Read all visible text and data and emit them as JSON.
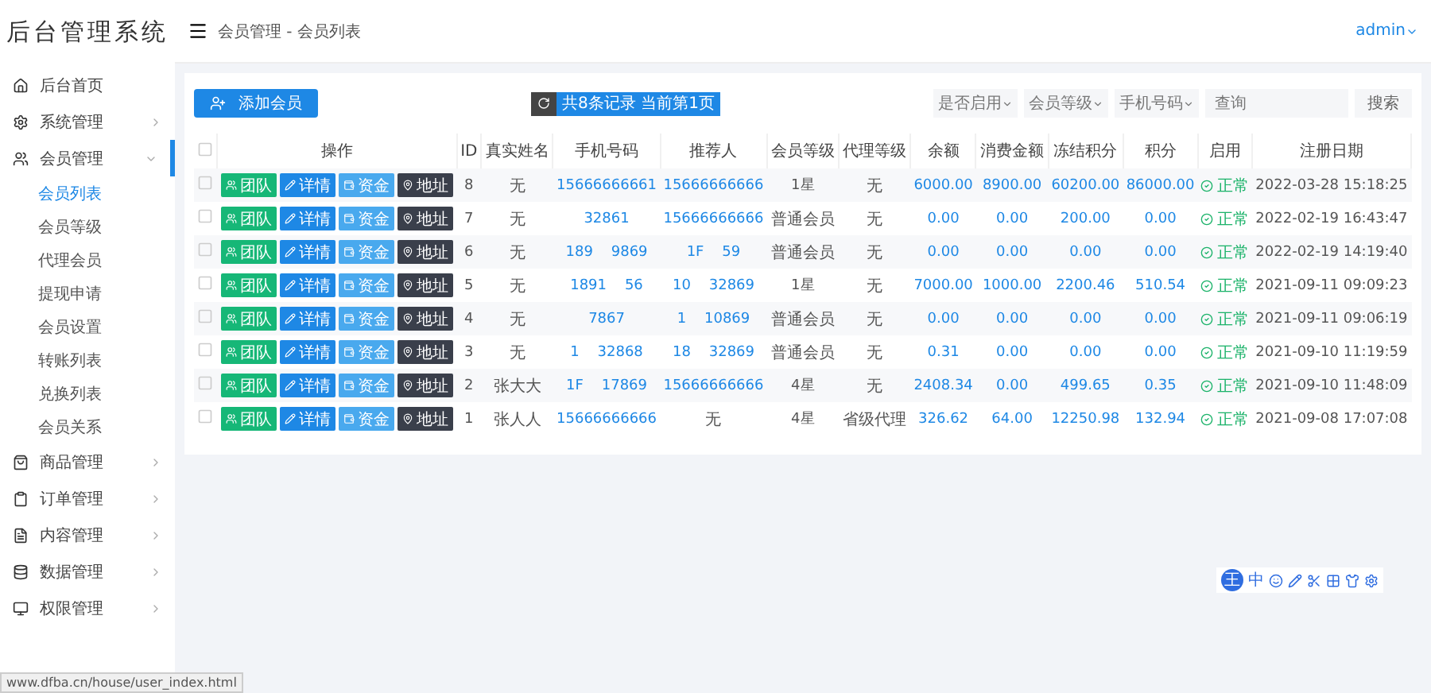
{
  "brand": "后台管理系统",
  "breadcrumb": "会员管理 - 会员列表",
  "user": "admin",
  "sidebar": {
    "items": [
      {
        "label": "后台首页",
        "expanded": false
      },
      {
        "label": "系统管理",
        "expanded": false
      },
      {
        "label": "会员管理",
        "expanded": true,
        "children": [
          {
            "label": "会员列表",
            "selected": true
          },
          {
            "label": "会员等级",
            "selected": false
          },
          {
            "label": "代理会员",
            "selected": false
          },
          {
            "label": "提现申请",
            "selected": false
          },
          {
            "label": "会员设置",
            "selected": false
          },
          {
            "label": "转账列表",
            "selected": false
          },
          {
            "label": "兑换列表",
            "selected": false
          },
          {
            "label": "会员关系",
            "selected": false
          }
        ]
      },
      {
        "label": "商品管理",
        "expanded": false
      },
      {
        "label": "订单管理",
        "expanded": false
      },
      {
        "label": "内容管理",
        "expanded": false
      },
      {
        "label": "数据管理",
        "expanded": false
      },
      {
        "label": "权限管理",
        "expanded": false
      }
    ]
  },
  "toolbar": {
    "add_button": "添加会员",
    "record_info": "共8条记录 当前第1页",
    "filters": [
      "是否启用",
      "会员等级",
      "手机号码"
    ],
    "search": {
      "placeholder": "查询"
    },
    "search_button": "搜索"
  },
  "table": {
    "select_all": {
      "checked": false
    },
    "columns": [
      "操作",
      "ID",
      "真实姓名",
      "手机号码",
      "推荐人",
      "会员等级",
      "代理等级",
      "余额",
      "消费金额",
      "冻结积分",
      "积分",
      "启用",
      "注册日期"
    ],
    "rows": [
      {
        "checked": false,
        "actions": [
          "团队",
          "详情",
          "资金",
          "地址"
        ],
        "id": "8",
        "name": "无",
        "phone": "15666666661",
        "referrer": "15666666666",
        "level": "1星",
        "agent": "无",
        "balance": "6000.00",
        "spent": "8900.00",
        "frozen": "60200.00",
        "points": "86000.00",
        "status": "正常",
        "date": "2022-03-28 15:18:25"
      },
      {
        "checked": false,
        "actions": [
          "团队",
          "详情",
          "资金",
          "地址"
        ],
        "id": "7",
        "name": "无",
        "phone": "32861",
        "referrer": "15666666666",
        "level": "普通会员",
        "agent": "无",
        "balance": "0.00",
        "spent": "0.00",
        "frozen": "200.00",
        "points": "0.00",
        "status": "正常",
        "date": "2022-02-19 16:43:47"
      },
      {
        "checked": false,
        "actions": [
          "团队",
          "详情",
          "资金",
          "地址"
        ],
        "id": "6",
        "name": "无",
        "phone": "189    9869",
        "referrer": "1F    59",
        "level": "普通会员",
        "agent": "无",
        "balance": "0.00",
        "spent": "0.00",
        "frozen": "0.00",
        "points": "0.00",
        "status": "正常",
        "date": "2022-02-19 14:19:40"
      },
      {
        "checked": false,
        "actions": [
          "团队",
          "详情",
          "资金",
          "地址"
        ],
        "id": "5",
        "name": "无",
        "phone": "1891    56",
        "referrer": "10    32869",
        "level": "1星",
        "agent": "无",
        "balance": "7000.00",
        "spent": "1000.00",
        "frozen": "2200.46",
        "points": "510.54",
        "status": "正常",
        "date": "2021-09-11 09:09:23"
      },
      {
        "checked": false,
        "actions": [
          "团队",
          "详情",
          "资金",
          "地址"
        ],
        "id": "4",
        "name": "无",
        "phone": "7867",
        "referrer": "1    10869",
        "level": "普通会员",
        "agent": "无",
        "balance": "0.00",
        "spent": "0.00",
        "frozen": "0.00",
        "points": "0.00",
        "status": "正常",
        "date": "2021-09-11 09:06:19"
      },
      {
        "checked": false,
        "actions": [
          "团队",
          "详情",
          "资金",
          "地址"
        ],
        "id": "3",
        "name": "无",
        "phone": "1    32868",
        "referrer": "18    32869",
        "level": "普通会员",
        "agent": "无",
        "balance": "0.31",
        "spent": "0.00",
        "frozen": "0.00",
        "points": "0.00",
        "status": "正常",
        "date": "2021-09-10 11:19:59"
      },
      {
        "checked": false,
        "actions": [
          "团队",
          "详情",
          "资金",
          "地址"
        ],
        "id": "2",
        "name": "张大大",
        "phone": "1F    17869",
        "referrer": "15666666666",
        "level": "4星",
        "agent": "无",
        "balance": "2408.34",
        "spent": "0.00",
        "frozen": "499.65",
        "points": "0.35",
        "status": "正常",
        "date": "2021-09-10 11:48:09"
      },
      {
        "checked": false,
        "actions": [
          "团队",
          "详情",
          "资金",
          "地址"
        ],
        "id": "1",
        "name": "张人人",
        "phone": "15666666666",
        "referrer": "无",
        "level": "4星",
        "agent": "省级代理",
        "balance": "326.62",
        "spent": "64.00",
        "frozen": "12250.98",
        "points": "132.94",
        "status": "正常",
        "date": "2021-09-08 17:07:08"
      }
    ]
  },
  "ime_toolbar": {
    "logo": "王",
    "mode": "中"
  },
  "status_url": "www.dfba.cn/house/user_index.html"
}
